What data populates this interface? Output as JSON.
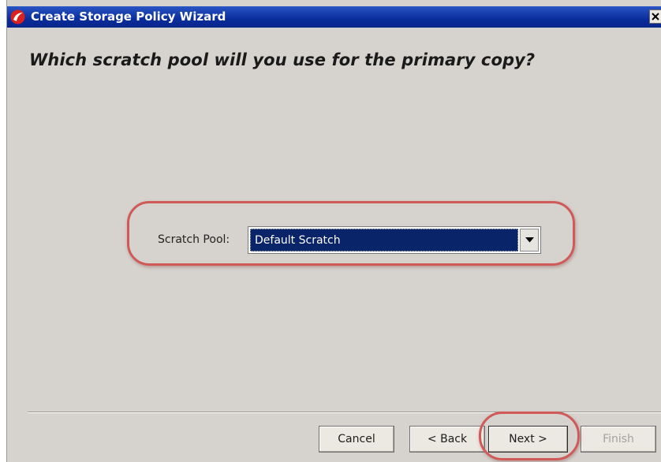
{
  "window": {
    "title": "Create Storage Policy Wizard",
    "close_glyph": "×",
    "icon": "commvault-logo-icon"
  },
  "page": {
    "heading": "Which scratch pool will you use for the primary copy?"
  },
  "form": {
    "scratch_pool_label": "Scratch Pool:",
    "scratch_pool_value": "Default Scratch"
  },
  "buttons": {
    "cancel": "Cancel",
    "back": "< Back",
    "next": "Next >",
    "finish": "Finish"
  },
  "colors": {
    "titlebar": "#0a2d9c",
    "selection": "#0a246a",
    "highlight": "#cf5a58",
    "window_bg": "#d6d3ce"
  }
}
